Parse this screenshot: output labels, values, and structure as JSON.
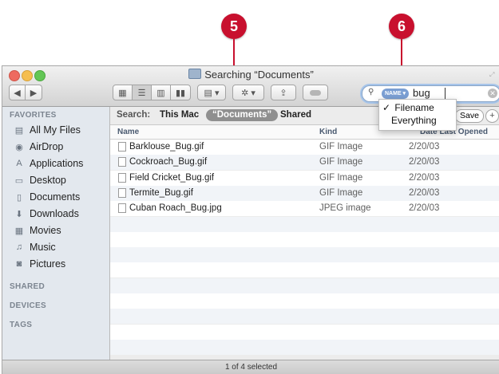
{
  "callouts": [
    {
      "number": "5"
    },
    {
      "number": "6"
    }
  ],
  "window": {
    "title": "Searching “Documents”"
  },
  "search": {
    "token": "NAME ▾",
    "query": "bug"
  },
  "search_menu": {
    "options": [
      "Filename",
      "Everything"
    ],
    "selected": "Filename",
    "checkmark": "✓"
  },
  "scope_bar": {
    "label": "Search:",
    "options": [
      "This Mac",
      "“Documents”",
      "Shared"
    ],
    "selected": "“Documents”",
    "save_label": "Save",
    "add_label": "+"
  },
  "sidebar": {
    "favorites_header": "FAVORITES",
    "favorites": [
      {
        "label": "All My Files",
        "icon": "all-files-icon"
      },
      {
        "label": "AirDrop",
        "icon": "airdrop-icon"
      },
      {
        "label": "Applications",
        "icon": "applications-icon"
      },
      {
        "label": "Desktop",
        "icon": "desktop-icon"
      },
      {
        "label": "Documents",
        "icon": "documents-icon"
      },
      {
        "label": "Downloads",
        "icon": "downloads-icon"
      },
      {
        "label": "Movies",
        "icon": "movies-icon"
      },
      {
        "label": "Music",
        "icon": "music-icon"
      },
      {
        "label": "Pictures",
        "icon": "pictures-icon"
      }
    ],
    "shared_header": "SHARED",
    "devices_header": "DEVICES",
    "tags_header": "TAGS"
  },
  "table": {
    "columns": {
      "name": "Name",
      "kind": "Kind",
      "date": "Date Last Opened"
    },
    "rows": [
      {
        "name": "Barklouse_Bug.gif",
        "kind": "GIF Image",
        "date": "2/20/03"
      },
      {
        "name": "Cockroach_Bug.gif",
        "kind": "GIF Image",
        "date": "2/20/03"
      },
      {
        "name": "Field Cricket_Bug.gif",
        "kind": "GIF Image",
        "date": "2/20/03"
      },
      {
        "name": "Termite_Bug.gif",
        "kind": "GIF Image",
        "date": "2/20/03"
      },
      {
        "name": "Cuban Roach_Bug.jpg",
        "kind": "JPEG image",
        "date": "2/20/03"
      }
    ]
  },
  "status": {
    "text": "1 of 4 selected"
  },
  "colors": {
    "callout": "#c8102e",
    "sidebar_bg": "#e3e8ee",
    "selected_scope": "#8f8f8f",
    "search_token": "#7b9fd3"
  }
}
